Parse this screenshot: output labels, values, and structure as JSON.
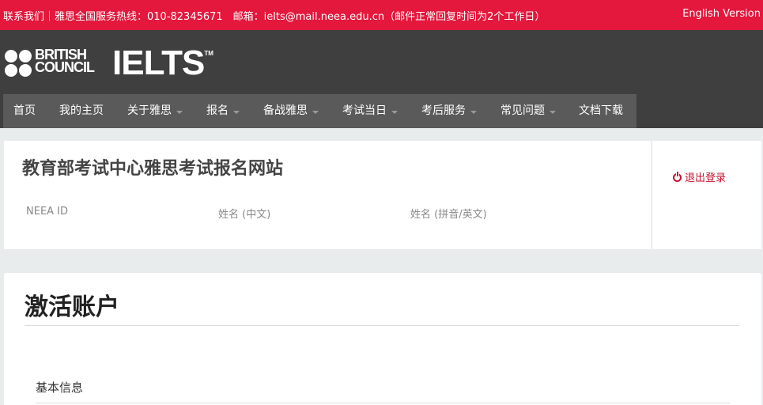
{
  "topbar": {
    "contact": "联系我们｜雅思全国服务热线：010-82345671　邮箱：ielts@mail.neea.edu.cn（邮件正常回复时间为2个工作日）",
    "language": "English Version"
  },
  "brand": {
    "bc_line1": "BRITISH",
    "bc_line2": "COUNCIL",
    "ielts": "IELTS",
    "tm": "TM"
  },
  "nav": {
    "items": [
      {
        "label": "首页",
        "dropdown": false
      },
      {
        "label": "我的主页",
        "dropdown": false
      },
      {
        "label": "关于雅思",
        "dropdown": true
      },
      {
        "label": "报名",
        "dropdown": true
      },
      {
        "label": "备战雅思",
        "dropdown": true
      },
      {
        "label": "考试当日",
        "dropdown": true
      },
      {
        "label": "考后服务",
        "dropdown": true
      },
      {
        "label": "常见问题",
        "dropdown": true
      },
      {
        "label": "文档下载",
        "dropdown": false
      }
    ]
  },
  "info": {
    "title": "教育部考试中心雅思考试报名网站",
    "fields": [
      "NEEA ID",
      "姓名 (中文)",
      "姓名 (拼音/英文)"
    ]
  },
  "account": {
    "logout": "退出登录"
  },
  "main": {
    "title": "激活账户",
    "section": "基本信息"
  },
  "colors": {
    "topbar": "#e4173c",
    "header": "#3f3f40",
    "nav": "#5a5a5b",
    "accent": "#c8102e",
    "page_bg": "#e9eced"
  },
  "icons": {
    "logout": "power-icon",
    "dropdown": "caret-down-icon",
    "logo": "british-council-logo-icon"
  }
}
